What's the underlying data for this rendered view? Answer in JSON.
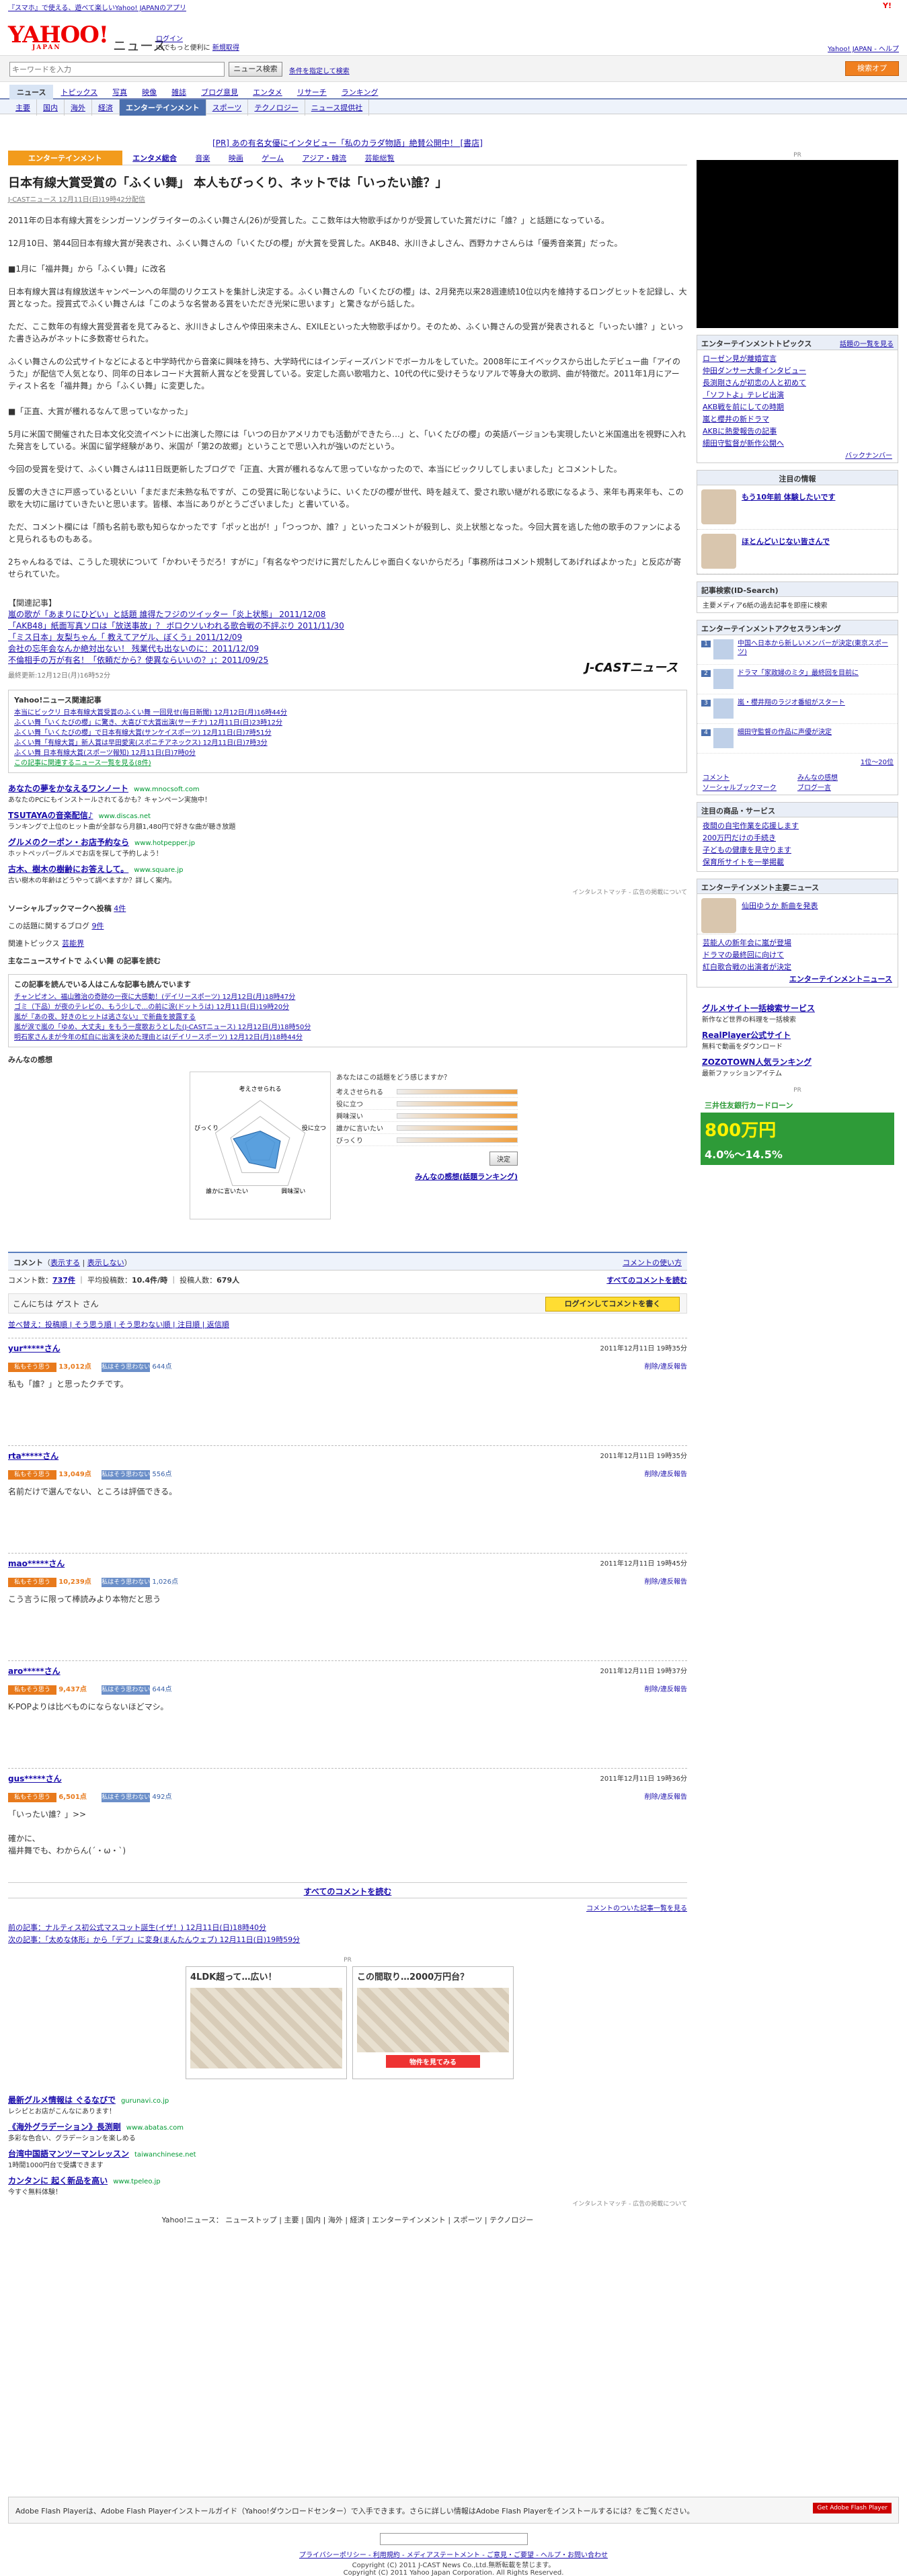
{
  "top": {
    "note": "『スマホ』で使える、遊べて楽しいYahoo! JAPANのアプリ"
  },
  "header": {
    "logo": "YAHOO!",
    "logo_sub": "JAPAN",
    "title": "ニュース",
    "login_link": "ログイン",
    "login_sub": "IDでもっと便利に",
    "register": "新規取得",
    "right_links": "Yahoo! JAPAN - ヘルプ"
  },
  "search": {
    "placeholder": "キーワードを入力",
    "button": "ニュース検索",
    "advanced": "条件を指定して検索",
    "right_button": "検索オプ"
  },
  "nav1": [
    "ニュース",
    "トピックス",
    "写真",
    "映像",
    "雑誌",
    "ブログ意見",
    "エンタメ",
    "リサーチ",
    "ランキング"
  ],
  "nav2": [
    "主要",
    "国内",
    "海外",
    "経済",
    "エンターテインメント",
    "スポーツ",
    "テクノロジー",
    "ニュース提供社"
  ],
  "pr_line": "[PR] あの有名女優にインタビュー「私のカラダ物語」絶賛公開中！ [書店]",
  "cat_tabs": {
    "label": "エンターテインメント",
    "items": [
      "エンタメ総合",
      "音楽",
      "映画",
      "ゲーム",
      "アジア・韓流",
      "芸能総覧"
    ]
  },
  "article": {
    "title": "日本有線大賞受賞の「ふくい舞」 本人もびっくり、ネットでは「いったい誰？」",
    "byline": "J-CASTニュース 12月11日(日)19時42分配信",
    "p1": "2011年の日本有線大賞をシンガーソングライターのふくい舞さん(26)が受賞した。ここ数年は大物歌手ばかりが受賞していた賞だけに「誰？」と話題になっている。",
    "p2": "12月10日、第44回日本有線大賞が発表され、ふくい舞さんの「いくたびの櫻」が大賞を受賞した。AKB48、氷川きよしさん、西野カナさんらは「優秀音楽賞」だった。",
    "h1": "■1月に「福井舞」から「ふくい舞」に改名",
    "p3": "日本有線大賞は有線放送キャンペーンへの年間のリクエストを集計し決定する。ふくい舞さんの「いくたびの櫻」は、2月発売以来28週連続10位以内を維持するロングヒットを記録し、大賞となった。授賞式でふくい舞さんは「このような名誉ある賞をいただき光栄に思います」と驚きながら話した。",
    "p4": "ただ、ここ数年の有線大賞受賞者を見てみると、氷川きよしさんや倖田來未さん、EXILEといった大物歌手ばかり。そのため、ふくい舞さんの受賞が発表されると「いったい誰？」といった書き込みがネットに多数寄せられた。",
    "p5": "ふくい舞さんの公式サイトなどによると中学時代から音楽に興味を持ち、大学時代にはインディーズバンドでボーカルをしていた。2008年にエイベックスから出したデビュー曲「アイのうた」が配信で人気となり、同年の日本レコード大賞新人賞などを受賞している。安定した高い歌唱力と、10代の代に受けそうなリアルで等身大の歌詞、曲が特徴だ。2011年1月にアーティスト名を「福井舞」から「ふくい舞」に変更した。",
    "h2": "■「正直、大賞が穫れるなんて思っていなかった」",
    "p6": "5月に米国で開催された日本文化交流イベントに出演した際には「いつの日かアメリカでも活動ができたら…」と、「いくたびの櫻」の英語バージョンも実現したいと米国進出を視野に入れた発言をしている。米国に留学経験があり、米国が「第2の故郷」ということで思い入れが強いのだという。",
    "p7": "今回の受賞を受けて、ふくい舞さんは11日既更新したブログで「正直、大賞が穫れるなんて思っていなかったので、本当にビックリしてしまいました」とコメントした。",
    "p8": "反響の大きさに戸惑っているといい「まだまだ未熟な私ですが、この受賞に恥じないように、いくたびの櫻が世代、時を越えて、愛され歌い継がれる歌になるよう、来年も再来年も、この歌を大切に届けていきたいと思います。皆様、本当にありがとうございました」と書いている。",
    "p9": "ただ、コメント欄には「顔も名前も歌も知らなかったです「ポッと出が！」「つっつか、誰？」といったコメントが殺到し、炎上状態となった。今回大賞を逃した他の歌手のファンによると見られるものもある。",
    "p10": "2ちゃんねるでは、こうした現状について「かわいそうだろ！すがに」「有名なやつだけに賞だしたんじゃ面白くないからだろ」「事務所はコメント規制してあげればよかった」と反応が寄せられていた。",
    "rel_head": "【関連記事】",
    "rel": [
      "嵐の歌が「あまりにひどい」と話題 誰得たフジのツイッター「炎上状態」 2011/12/08",
      "「AKB48」紙面写真ソロは「放送事故」？ ボロクソいわれる歌合戦の不評ぶり 2011/11/30",
      "「ミス日本」友梨ちゃん「 教えてアゲル、ぼくう」2011/12/09",
      "会社の忘年会なんか絶対出ない！ 残業代も出ないのに：2011/12/09",
      "不倫相手の万が有名！「依頼だから？使異ならいいの？」：2011/09/25"
    ],
    "updated": "最終更新:12月12日(月)16時52分",
    "jcast": "J-CASTニュース"
  },
  "yahoo_topics": {
    "title": "Yahoo!ニュース関連記事",
    "items": [
      "本当にビックリ 日本有線大賞受賞のふくい舞 一回見せ(毎日新聞) 12月12日(月)16時44分",
      "ふくい舞「いくたびの櫻」に驚き、大喜びで大賞出演(サーチナ) 12月11日(日)23時12分",
      "ふくい舞「いくたびの櫻」で日本有線大賞(サンケイスポーツ) 12月11日(日)7時51分",
      "ふくい舞「有線大賞」新人賞は早田愛実(スポニチアネックス) 12月11日(日)7時3分",
      "ふくい舞 日本有線大賞(スポーツ報知) 12月11日(日)7時0分"
    ],
    "more": "この記事に関連するニュース一覧を見る(8件)"
  },
  "ads": [
    {
      "t": "あなたの夢をかなえるワンノート",
      "u": "www.mnocsoft.com",
      "d": "あなたのPCにもインストールされてるかも？キャンペーン実施中！"
    },
    {
      "t": "TSUTAYAの音楽配信♪",
      "u": "www.discas.net",
      "d": "ランキングで上位のヒット曲が全部なら月額1,480円で好きな曲が聴き放題"
    },
    {
      "t": "グルメのクーポン・お店予約なら",
      "u": "www.hotpepper.jp",
      "d": "ホットペッパーグルメでお店を探して予約しよう！"
    },
    {
      "t": "古木、樹木の樹齢にお答えして。",
      "u": "www.square.jp",
      "d": "古い樹木の年齢はどうやって調べますか？詳しく案内。"
    }
  ],
  "ad_credit": "インタレストマッチ - 広告の掲載について",
  "social": {
    "label": "ソーシャルブックマークへ投稿",
    "count": "4件"
  },
  "blogs": {
    "label": "この話題に関するブログ",
    "count": "9件"
  },
  "related": {
    "label": "関連トピックス",
    "val": "芸能界"
  },
  "main_site": "主なニュースサイトで ふくい舞 の記事を読む",
  "also_read": {
    "title": "この記事を読んでいる人はこんな記事も読んでいます",
    "items": [
      "チャンピオン、福山雅治の奇跡の一夜に大感動！(デイリースポーツ) 12月12日(月)18時47分",
      "ゴミ（下品）が夜のテレビの、もう少しで…の前に涙(ドットうは) 12月11日(日)19時20分",
      "嵐が『あの夜、好きのヒットは逃さない』で新曲を披露する",
      "嵐が涙で嵐の「ゆめ、大丈夫」をもう一度歌おうとした(J-CASTニュース) 12月12日(月)18時50分",
      "明石家さんまが今年の紅白に出演を決めた理由とは(デイリースポーツ) 12月12日(月)18時44分"
    ]
  },
  "minna": {
    "title": "みんなの感想",
    "question": "あなたはこの話題をどう感じますか？",
    "axes": [
      "考えさせられる",
      "役に立つ",
      "興味深い",
      "誰かに言いたい",
      "びっくり"
    ],
    "values": [
      0.35,
      0.45,
      0.55,
      0.4,
      0.6
    ],
    "vote": "決定",
    "link": "みんなの感想(話題ランキング)"
  },
  "comments_header": {
    "title": "コメント",
    "show": "表示する",
    "hide": "表示しない",
    "rule": "コメントの使い方",
    "count_label": "コメント数",
    "count": "737件",
    "avg_label": "平均投稿数",
    "avg": "10.4件/時",
    "people_label": "投稿人数",
    "people": "679人",
    "see_all": "すべてのコメントを読む"
  },
  "guest": {
    "text": "こんにちは ゲスト さん",
    "login": "ログインしてコメントを書く"
  },
  "sortbar": "並べ替え：投稿順 | そう思う順 | そう思わない順 | 注目順 | 返信順",
  "comments": [
    {
      "user": "yur*****さん",
      "date": "2011年12月11日 19時35分",
      "good": "13,012点",
      "bad": "644点",
      "text": "私も「誰？」と思ったクチです。"
    },
    {
      "user": "rta*****さん",
      "date": "2011年12月11日 19時35分",
      "good": "13,049点",
      "bad": "556点",
      "text": "名前だけで選んでない、ところは評価できる。"
    },
    {
      "user": "mao*****さん",
      "date": "2011年12月11日 19時45分",
      "good": "10,239点",
      "bad": "1,026点",
      "text": "こう言うに限って棒読みより本物だと思う"
    },
    {
      "user": "aro*****さん",
      "date": "2011年12月11日 19時37分",
      "good": "9,437点",
      "bad": "644点",
      "text": "K-POPよりは比べものにならないほどマシ。"
    },
    {
      "user": "gus*****さん",
      "date": "2011年12月11日 19時36分",
      "good": "6,501点",
      "bad": "492点",
      "text": "「いったい誰？」>>\n\n確かに、\n福井舞でも、わからん(´・ω・`)"
    }
  ],
  "vote_good": "私もそう思う",
  "vote_bad": "私はそう思わない",
  "delete_label": "削除/違反報告",
  "read_all": "すべてのコメントを読む",
  "rule_link": "コメントのついた記事一覧を見る",
  "pager": {
    "prev": "前の記事：ナルティス初公式マスコット誕生(イザ！) 12月11日(日)18時40分",
    "next": "次の記事：「太めな体形」から「デブ」に変身(まんたんウェブ) 12月11日(日)19時59分"
  },
  "house": {
    "pr": "PR",
    "a": "4LDK超って…広い！",
    "b": "この間取り…2000万円台？",
    "btn": "物件を見てみる"
  },
  "ads2": [
    {
      "t": "最新グルメ情報は ぐるなびで",
      "u": "gurunavi.co.jp",
      "d": "レシピとお店がこんなにあります！"
    },
    {
      "t": "《海外グラデーション》長渕剛",
      "u": "www.abatas.com",
      "d": "多彩な色合い、グラデーションを楽しめる"
    },
    {
      "t": "台湾中国語マンツーマンレッスン",
      "u": "taiwanchinese.net",
      "d": "1時間1000円台で受講できます"
    },
    {
      "t": "カンタンに 起く新品を高い",
      "u": "www.tpeleo.jp",
      "d": "今すぐ無料体験！"
    }
  ],
  "footnav": "Yahoo!ニュース： ニューストップ | 主要 | 国内 | 海外 | 経済 | エンターテインメント | スポーツ | テクノロジー",
  "flash": "Adobe Flash Playerは、Adobe Flash Playerインストールガイド（Yahoo!ダウンロードセンター）で入手できます。さらに詳しい情報はAdobe Flash Playerをインストールするには？をご覧ください。",
  "flash_badge": "Get Adobe Flash Player",
  "footer": {
    "links": "プライバシーポリシー - 利用規約 - メディアステートメント - ご意見・ご要望 - ヘルプ・お問い合わせ",
    "copy1": "Copyright (C) 2011 J-CAST News Co.,Ltd.無断転載を禁じます。",
    "copy2": "Copyright (C) 2011 Yahoo Japan Corporation. All Rights Reserved."
  },
  "side": {
    "ad_pr": "PR",
    "topics_title": "エンターテインメントトピックス",
    "topics_link": "話題の一覧を見る",
    "topics": [
      "ローゼン見が離婚宣言",
      "仲田ダンサー大衆インタビュー",
      "長渕剛さんが初恋の人と初めて",
      "「ソフトよ」テレビ出演",
      "AKB戦を前にしての時期",
      "嵐と櫻井の新ドラマ",
      "AKBに熱愛報告の記事",
      "細田守監督が新作公開へ"
    ],
    "backnum": "バックナンバー",
    "notice_title": "注目の情報",
    "notice1": "もう10年前 体験したいです",
    "notice2": "ほとんどいじない皆さんで",
    "iq_title": "記事検索(ID-Search)",
    "iq": "主要メディア6紙の過去記事を即座に検索",
    "access_title": "エンターテインメントアクセスランキング",
    "access": [
      "中国へ日本から新しいメンバーが決定(東京スポーツ)",
      "ドラマ「家政婦のミタ」最終回を目前に",
      "嵐・櫻井翔のラジオ番組がスタート",
      "細田守監督の作品に声優が決定"
    ],
    "ranking_more": "1位〜20位",
    "ranks": [
      "コメント",
      "みんなの感想",
      "ソーシャルブックマーク",
      "ブログ一言"
    ],
    "goods_title": "注目の商品・サービス",
    "goods": [
      "夜間の自宅作業を応援します",
      "200万円だけの手続き",
      "子どもの健康を見守ります",
      "保育所サイトを一挙掲載"
    ],
    "mainnews_title": "エンターテインメント主要ニュース",
    "mainnews": [
      "仙田ゆうか 新曲を発表",
      "芸能人の新年会に嵐が登場",
      "ドラマの最終回に向けて",
      "紅白歌合戦の出演者が決定"
    ],
    "entertain_link": "エンターテインメントニュース",
    "ad2": [
      {
        "t": "グルメサイト一括検索サービス",
        "d": "新作など世界の料理を一括検索"
      },
      {
        "t": "RealPlayer公式サイト",
        "d": "無料で動画をダウンロード"
      },
      {
        "t": "ZOZOTOWN人気ランキング",
        "d": "最新ファッションアイテム"
      }
    ],
    "bnr_title": "三井住友銀行カードローン",
    "bnr_amount": "800万円",
    "bnr_rate": "4.0%〜14.5%"
  }
}
